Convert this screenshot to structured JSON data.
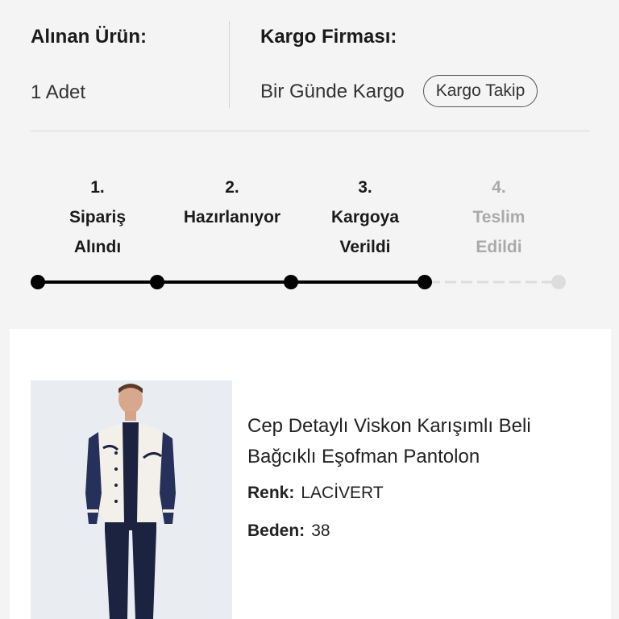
{
  "order": {
    "quantity_label": "Alınan Ürün:",
    "quantity_value": "1 Adet",
    "carrier_label": "Kargo Firması:",
    "carrier_value": "Bir Günde Kargo",
    "track_button": "Kargo Takip"
  },
  "steps": [
    {
      "num": "1.",
      "line1": "Sipariş",
      "line2": "Alındı",
      "done": true
    },
    {
      "num": "2.",
      "line1": "Hazırlanıyor",
      "line2": "",
      "done": true
    },
    {
      "num": "3.",
      "line1": "Kargoya",
      "line2": "Verildi",
      "done": true
    },
    {
      "num": "4.",
      "line1": "Teslim",
      "line2": "Edildi",
      "done": false
    }
  ],
  "product": {
    "title": "Cep Detaylı Viskon Karışımlı Beli Bağcıklı Eşofman Pantolon",
    "color_label": "Renk:",
    "color_value": "LACİVERT",
    "size_label": "Beden:",
    "size_value": "38",
    "image_icon": "product-photo"
  },
  "colors": {
    "panel_bg": "#f4f4f4",
    "step_active": "#000000",
    "step_inactive": "#dddddd"
  }
}
